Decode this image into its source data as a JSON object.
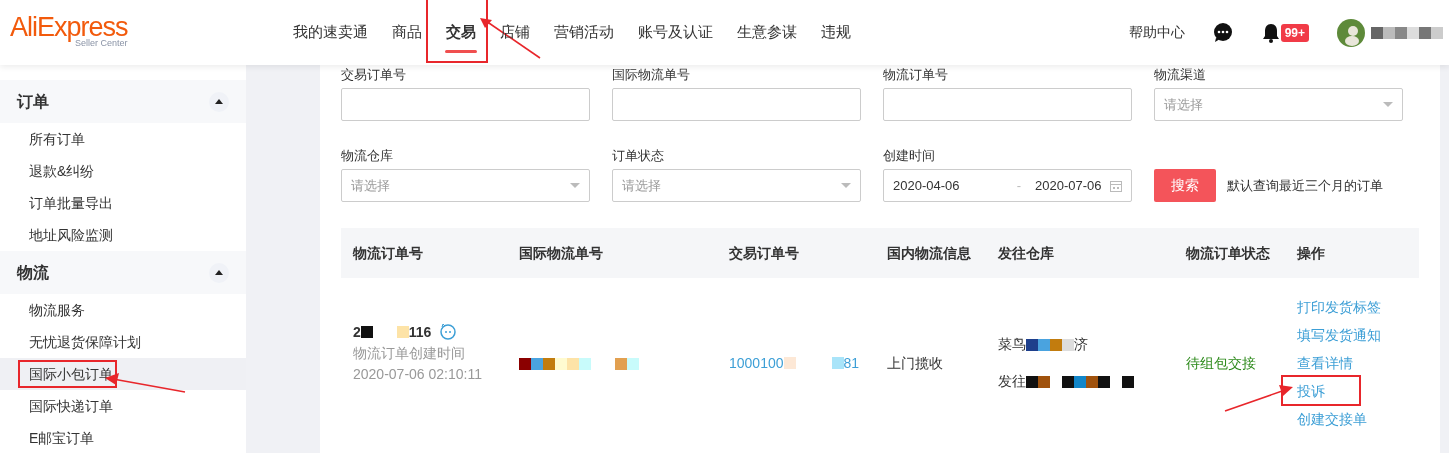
{
  "header": {
    "logo": "AliExpress",
    "logo_sub": "Seller Center",
    "nav": [
      {
        "label": "我的速卖通",
        "selected": false,
        "highlighted": false
      },
      {
        "label": "商品",
        "selected": false,
        "highlighted": false
      },
      {
        "label": "交易",
        "selected": true,
        "highlighted": true
      },
      {
        "label": "店铺",
        "selected": false,
        "highlighted": false
      },
      {
        "label": "营销活动",
        "selected": false,
        "highlighted": false
      },
      {
        "label": "账号及认证",
        "selected": false,
        "highlighted": false
      },
      {
        "label": "生意参谋",
        "selected": false,
        "highlighted": false
      },
      {
        "label": "违规",
        "selected": false,
        "highlighted": false
      }
    ],
    "help": "帮助中心",
    "notification_badge": "99+"
  },
  "sidebar": {
    "groups": [
      {
        "title": "订单",
        "expanded": true,
        "items": [
          {
            "label": "所有订单",
            "selected": false,
            "highlighted": false
          },
          {
            "label": "退款&纠纷",
            "selected": false,
            "highlighted": false
          },
          {
            "label": "订单批量导出",
            "selected": false,
            "highlighted": false
          },
          {
            "label": "地址风险监测",
            "selected": false,
            "highlighted": false
          }
        ]
      },
      {
        "title": "物流",
        "expanded": true,
        "items": [
          {
            "label": "物流服务",
            "selected": false,
            "highlighted": false
          },
          {
            "label": "无忧退货保障计划",
            "selected": false,
            "highlighted": false
          },
          {
            "label": "国际小包订单",
            "selected": true,
            "highlighted": true
          },
          {
            "label": "国际快递订单",
            "selected": false,
            "highlighted": false
          },
          {
            "label": "E邮宝订单",
            "selected": false,
            "highlighted": false
          }
        ]
      }
    ]
  },
  "filters": [
    {
      "label": "交易订单号",
      "kind": "text"
    },
    {
      "label": "国际物流单号",
      "kind": "text"
    },
    {
      "label": "物流订单号",
      "kind": "text"
    },
    {
      "label": "物流渠道",
      "kind": "select",
      "placeholder": "请选择"
    },
    {
      "label": "物流仓库",
      "kind": "select",
      "placeholder": "请选择"
    },
    {
      "label": "订单状态",
      "kind": "select",
      "placeholder": "请选择"
    },
    {
      "label": "创建时间",
      "kind": "daterange",
      "start": "2020-04-06",
      "separator": "-",
      "end": "2020-07-06"
    }
  ],
  "search_button": "搜索",
  "search_hint": "默认查询最近三个月的订单",
  "table": {
    "columns": [
      "物流订单号",
      "国际物流单号",
      "交易订单号",
      "国内物流信息",
      "发往仓库",
      "物流订单状态",
      "操作"
    ],
    "rows": [
      {
        "logistics_order_prefix": "2",
        "logistics_order_suffix": "116",
        "created_label": "物流订单创建时间",
        "created_at": "2020-07-06 02:10:11",
        "trade_order_prefix": "1000100",
        "trade_order_suffix": "81",
        "domestic_info": "上门揽收",
        "warehouse_prefix": "菜鸟",
        "warehouse_suffix": "济",
        "warehouse_line2": "发往",
        "status": "待组包交接",
        "actions": [
          {
            "label": "打印发货标签",
            "highlighted": false
          },
          {
            "label": "填写发货通知",
            "highlighted": false
          },
          {
            "label": "查看详情",
            "highlighted": false
          },
          {
            "label": "投诉",
            "highlighted": true
          },
          {
            "label": "创建交接单",
            "highlighted": false
          }
        ]
      }
    ]
  }
}
